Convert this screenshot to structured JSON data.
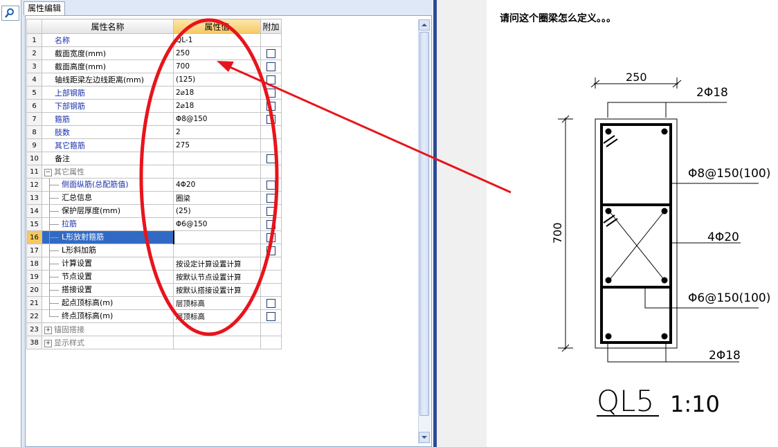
{
  "search": {
    "icon": "search-icon"
  },
  "tab": {
    "label": "属性编辑"
  },
  "table": {
    "headers": {
      "name": "属性名称",
      "value": "属性值",
      "add": "附加"
    },
    "rows": [
      {
        "num": "1",
        "name": "名称",
        "value": "QL-1",
        "cb": false,
        "style": "blue",
        "level": 0
      },
      {
        "num": "2",
        "name": "截面宽度(mm)",
        "value": "250",
        "cb": true,
        "style": "",
        "level": 0
      },
      {
        "num": "3",
        "name": "截面高度(mm)",
        "value": "700",
        "cb": true,
        "style": "",
        "level": 0
      },
      {
        "num": "4",
        "name": "轴线距梁左边线距离(mm)",
        "value": "(125)",
        "cb": true,
        "style": "",
        "level": 0
      },
      {
        "num": "5",
        "name": "上部钢筋",
        "value": "2⌀18",
        "cb": true,
        "style": "blue",
        "level": 0
      },
      {
        "num": "6",
        "name": "下部钢筋",
        "value": "2⌀18",
        "cb": true,
        "style": "blue",
        "level": 0
      },
      {
        "num": "7",
        "name": "箍筋",
        "value": "Φ8@150",
        "cb": true,
        "style": "blue",
        "level": 0
      },
      {
        "num": "8",
        "name": "肢数",
        "value": "2",
        "cb": false,
        "style": "blue",
        "level": 0
      },
      {
        "num": "9",
        "name": "其它箍筋",
        "value": "275",
        "cb": false,
        "style": "blue",
        "level": 0
      },
      {
        "num": "10",
        "name": "备注",
        "value": "",
        "cb": true,
        "style": "",
        "level": 0
      },
      {
        "num": "11",
        "name": "其它属性",
        "value": "",
        "cb": false,
        "style": "gray",
        "level": "group-open"
      },
      {
        "num": "12",
        "name": "侧面纵筋(总配筋值)",
        "value": "4Φ20",
        "cb": true,
        "style": "blue",
        "level": 1
      },
      {
        "num": "13",
        "name": "汇总信息",
        "value": "圈梁",
        "cb": true,
        "style": "",
        "level": 1
      },
      {
        "num": "14",
        "name": "保护层厚度(mm)",
        "value": "(25)",
        "cb": true,
        "style": "",
        "level": 1
      },
      {
        "num": "15",
        "name": "拉筋",
        "value": "Φ6@150",
        "cb": true,
        "style": "blue",
        "level": 1
      },
      {
        "num": "16",
        "name": "L形放射箍筋",
        "value": "",
        "cb": true,
        "style": "sel",
        "level": 1
      },
      {
        "num": "17",
        "name": "L形斜加筋",
        "value": "",
        "cb": true,
        "style": "",
        "level": 1
      },
      {
        "num": "18",
        "name": "计算设置",
        "value": "按设定计算设置计算",
        "cb": false,
        "style": "",
        "level": 1
      },
      {
        "num": "19",
        "name": "节点设置",
        "value": "按默认节点设置计算",
        "cb": false,
        "style": "",
        "level": 1
      },
      {
        "num": "20",
        "name": "搭接设置",
        "value": "按默认搭接设置计算",
        "cb": false,
        "style": "",
        "level": 1
      },
      {
        "num": "21",
        "name": "起点顶标高(m)",
        "value": "层顶标高",
        "cb": true,
        "style": "",
        "level": 1
      },
      {
        "num": "22",
        "name": "终点顶标高(m)",
        "value": "层顶标高",
        "cb": true,
        "style": "",
        "level": "1-last"
      },
      {
        "num": "23",
        "name": "锚固搭接",
        "value": "",
        "cb": false,
        "style": "gray",
        "level": "group-closed"
      },
      {
        "num": "38",
        "name": "显示样式",
        "value": "",
        "cb": false,
        "style": "gray",
        "level": "group-closed"
      }
    ]
  },
  "post": {
    "question": "请问这个圈梁怎么定义。。。"
  },
  "drawing": {
    "width_dim": "250",
    "height_dim": "700",
    "top_bar": "2Φ18",
    "stirrup": "Φ8@150(100)",
    "side_bar": "4Φ20",
    "tie": "Φ6@150(100)",
    "bottom_bar": "2Φ18",
    "title": "QL5",
    "scale": "1:10"
  },
  "colors": {
    "annotation_red": "#e8141c",
    "selection": "#316ac5",
    "header_active": "#f6c860"
  }
}
